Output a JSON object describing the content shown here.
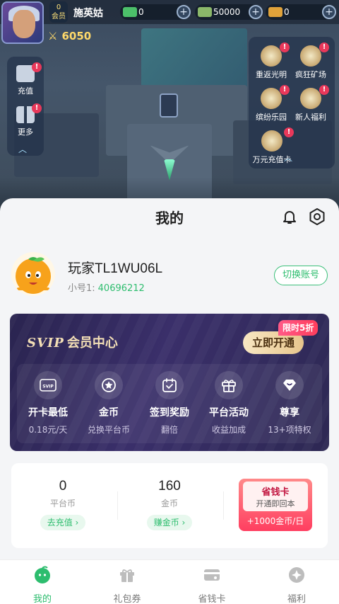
{
  "game": {
    "level": "0",
    "level_label": "会员",
    "player_name": "施英姑",
    "resources": [
      {
        "icon": "cash-icon",
        "value": "0"
      },
      {
        "icon": "banknote-icon",
        "value": "50000"
      },
      {
        "icon": "gold-bar-icon",
        "value": "0"
      }
    ],
    "power": "6050",
    "left_buttons": [
      {
        "label": "充值",
        "icon": "recharge-icon",
        "badge": "!"
      },
      {
        "label": "更多",
        "icon": "more-grid-icon",
        "badge": "!"
      }
    ],
    "right_buttons": [
      {
        "label": "重返光明",
        "icon": "return-light-icon",
        "badge": "!"
      },
      {
        "label": "疯狂矿场",
        "icon": "mine-icon",
        "badge": "!"
      },
      {
        "label": "缤纷乐园",
        "icon": "park-icon",
        "badge": "!"
      },
      {
        "label": "新人福利",
        "icon": "newbie-gift-icon",
        "badge": "!"
      },
      {
        "label": "万元充值卡",
        "icon": "card-icon",
        "badge": "!"
      }
    ]
  },
  "header": {
    "title": "我的"
  },
  "user": {
    "name": "玩家TL1WU06L",
    "sub_label": "小号1:",
    "sub_id": "40696212",
    "switch_label": "切换账号"
  },
  "svip": {
    "badge": "SVIP",
    "title": "会员中心",
    "open_label": "立即开通",
    "discount_label": "限时5折",
    "perks": [
      {
        "title": "开卡最低",
        "sub": "0.18元/天",
        "icon": "svip-card-icon"
      },
      {
        "title": "金币",
        "sub": "兑换平台币",
        "icon": "coin-icon"
      },
      {
        "title": "签到奖励",
        "sub": "翻倍",
        "icon": "calendar-check-icon"
      },
      {
        "title": "平台活动",
        "sub": "收益加成",
        "icon": "gift-box-icon"
      },
      {
        "title": "尊享",
        "sub": "13+项特权",
        "icon": "diamond-heart-icon"
      }
    ]
  },
  "wallet": {
    "platform_coin": {
      "value": "0",
      "label": "平台币",
      "action": "去充值 ›"
    },
    "gold_coin": {
      "value": "160",
      "label": "金币",
      "action": "赚金币 ›"
    },
    "saving_card": {
      "title": "省钱卡",
      "sub": "开通即回本",
      "bonus": "+1000金币/日"
    }
  },
  "tabbar": {
    "tabs": [
      {
        "label": "我的",
        "icon": "my-icon",
        "active": true
      },
      {
        "label": "礼包券",
        "icon": "gift-icon",
        "active": false
      },
      {
        "label": "省钱卡",
        "icon": "saving-card-icon",
        "active": false
      },
      {
        "label": "福利",
        "icon": "welfare-icon",
        "active": false
      }
    ]
  },
  "colors": {
    "accent": "#2dbd6e",
    "svip_bg": "#2a2450",
    "gold_text": "#f3dfb6",
    "red_badge": "#ff3d5c"
  }
}
